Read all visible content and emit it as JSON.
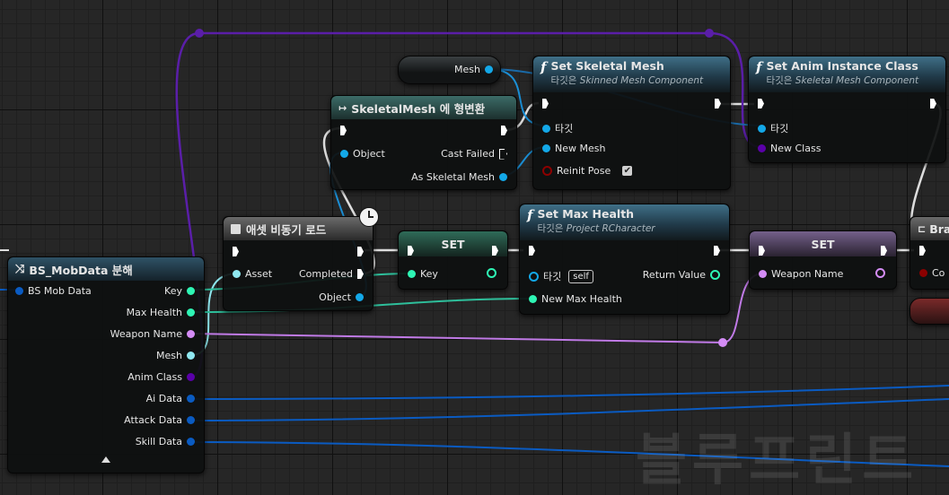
{
  "colors": {
    "exec": "#ffffff",
    "object": "#13a8e8",
    "name": "#d48cf5",
    "class": "#5a00a8",
    "struct": "#0a5bc2",
    "float": "#2ef5b4",
    "bool": "#8c0000"
  },
  "watermark": "블루프린트",
  "nodes": {
    "break_struct": {
      "title": "BS_MobData 분해",
      "icon": "break-struct-icon",
      "input": "BS Mob Data",
      "outputs": [
        "Key",
        "Max Health",
        "Weapon Name",
        "Mesh",
        "Anim Class",
        "Ai Data",
        "Attack Data",
        "Skill Data"
      ]
    },
    "async_load": {
      "title": "애셋 비동기 로드",
      "icon": "async-load-icon",
      "asset": "Asset",
      "completed": "Completed",
      "object": "Object"
    },
    "cast": {
      "title": "SkeletalMesh 에 형변환",
      "icon": "cast-icon",
      "object": "Object",
      "cast_failed": "Cast Failed",
      "as_mesh": "As Skeletal Mesh"
    },
    "mesh_getter": {
      "label": "Mesh"
    },
    "set_skeletal_mesh": {
      "title": "Set Skeletal Mesh",
      "sub_prefix": "타깃은",
      "sub_target": "Skinned Mesh Component",
      "target": "타깃",
      "new_mesh": "New Mesh",
      "reinit_pose": "Reinit Pose",
      "reinit_checked": true
    },
    "set_anim_class": {
      "title": "Set Anim Instance Class",
      "sub_prefix": "타깃은",
      "sub_target": "Skeletal Mesh Component",
      "target": "타깃",
      "new_class": "New Class"
    },
    "set_key": {
      "title": "SET",
      "pin": "Key"
    },
    "set_max_health": {
      "title": "Set Max Health",
      "sub_prefix": "타깃은",
      "sub_target": "Project RCharacter",
      "target": "타깃",
      "self": "self",
      "new_max_health": "New Max Health",
      "return_value": "Return Value"
    },
    "set_weapon": {
      "title": "SET",
      "pin": "Weapon Name"
    },
    "branch": {
      "title": "Bra",
      "condition": "Co"
    }
  }
}
